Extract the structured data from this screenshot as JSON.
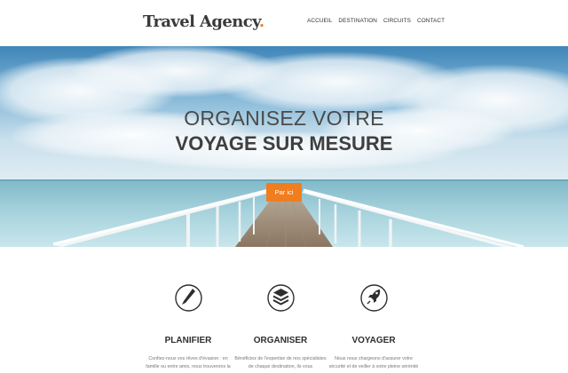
{
  "header": {
    "logo_text": "Travel Agency",
    "logo_dot": ".",
    "nav": [
      "ACCUEIL",
      "DESTINATION",
      "CIRCUITS",
      "CONTACT"
    ]
  },
  "hero": {
    "line1": "ORGANISEZ VOTRE",
    "line2": "VOYAGE SUR MESURE",
    "cta_label": "Par ici"
  },
  "features": [
    {
      "icon": "pencil-icon",
      "title": "PLANIFIER",
      "text": "Confiez-nous vos rêves d'évasion : en famille ou entre amis, nous trouverons la"
    },
    {
      "icon": "layers-icon",
      "title": "ORGANISER",
      "text": "Bénéficiez de l'expertise de nos spécialistes de chaque destination, ils vous"
    },
    {
      "icon": "rocket-icon",
      "title": "VOYAGER",
      "text": "Nous nous chargeons d'assurer votre sécurité et de veiller à votre pleine sérénité"
    }
  ],
  "colors": {
    "accent": "#f07d1e",
    "text_dark": "#3a3a3a",
    "text_muted": "#777777"
  }
}
